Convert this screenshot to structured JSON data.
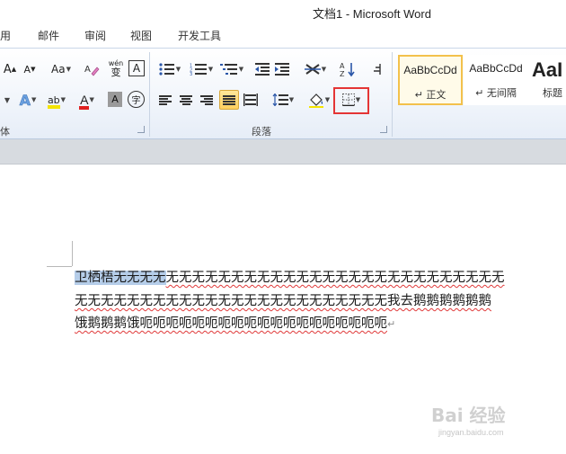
{
  "window": {
    "title": "文档1  -  Microsoft Word"
  },
  "tabs": [
    "用",
    "邮件",
    "审阅",
    "视图",
    "开发工具"
  ],
  "ribbon": {
    "font_group_label": "体",
    "paragraph_group_label": "段落",
    "font_buttons": {
      "grow": "A",
      "shrink": "A",
      "change_case": "Aa",
      "phonetic_top": "wén",
      "phonetic_bottom": "变",
      "char_border": "A",
      "text_effect": "A",
      "highlight": "ab",
      "font_color": "A",
      "char_shading": "A",
      "enclose": "字"
    },
    "colors": {
      "highlight": "#f5e400",
      "font_color": "#e02020",
      "selected_style_border": "#f3c14b",
      "callout_box": "#e43535"
    }
  },
  "styles": [
    {
      "sample": "AaBbCcDd",
      "name": "↵ 正文",
      "selected": true
    },
    {
      "sample": "AaBbCcDd",
      "name": "↵ 无间隔",
      "selected": false
    },
    {
      "sample": "AaI",
      "name": "标题",
      "selected": false
    }
  ],
  "document": {
    "line1_selected": "卫栖梧无无无无",
    "line1_rest": "无无无无无无无无无无无无无无无无无无无无无无无无无无",
    "line2": "无无无无无无无无无无无无无无无无无无无无无无无无我去鹅鹅鹅鹅鹅鹅",
    "line3": "饿鹅鹅鹅饿呃呃呃呃呃呃呃呃呃呃呃呃呃呃呃呃呃呃呃",
    "para_mark": "↵"
  },
  "watermark": {
    "text": "Bai 经验",
    "sub": "jingyan.baidu.com"
  }
}
